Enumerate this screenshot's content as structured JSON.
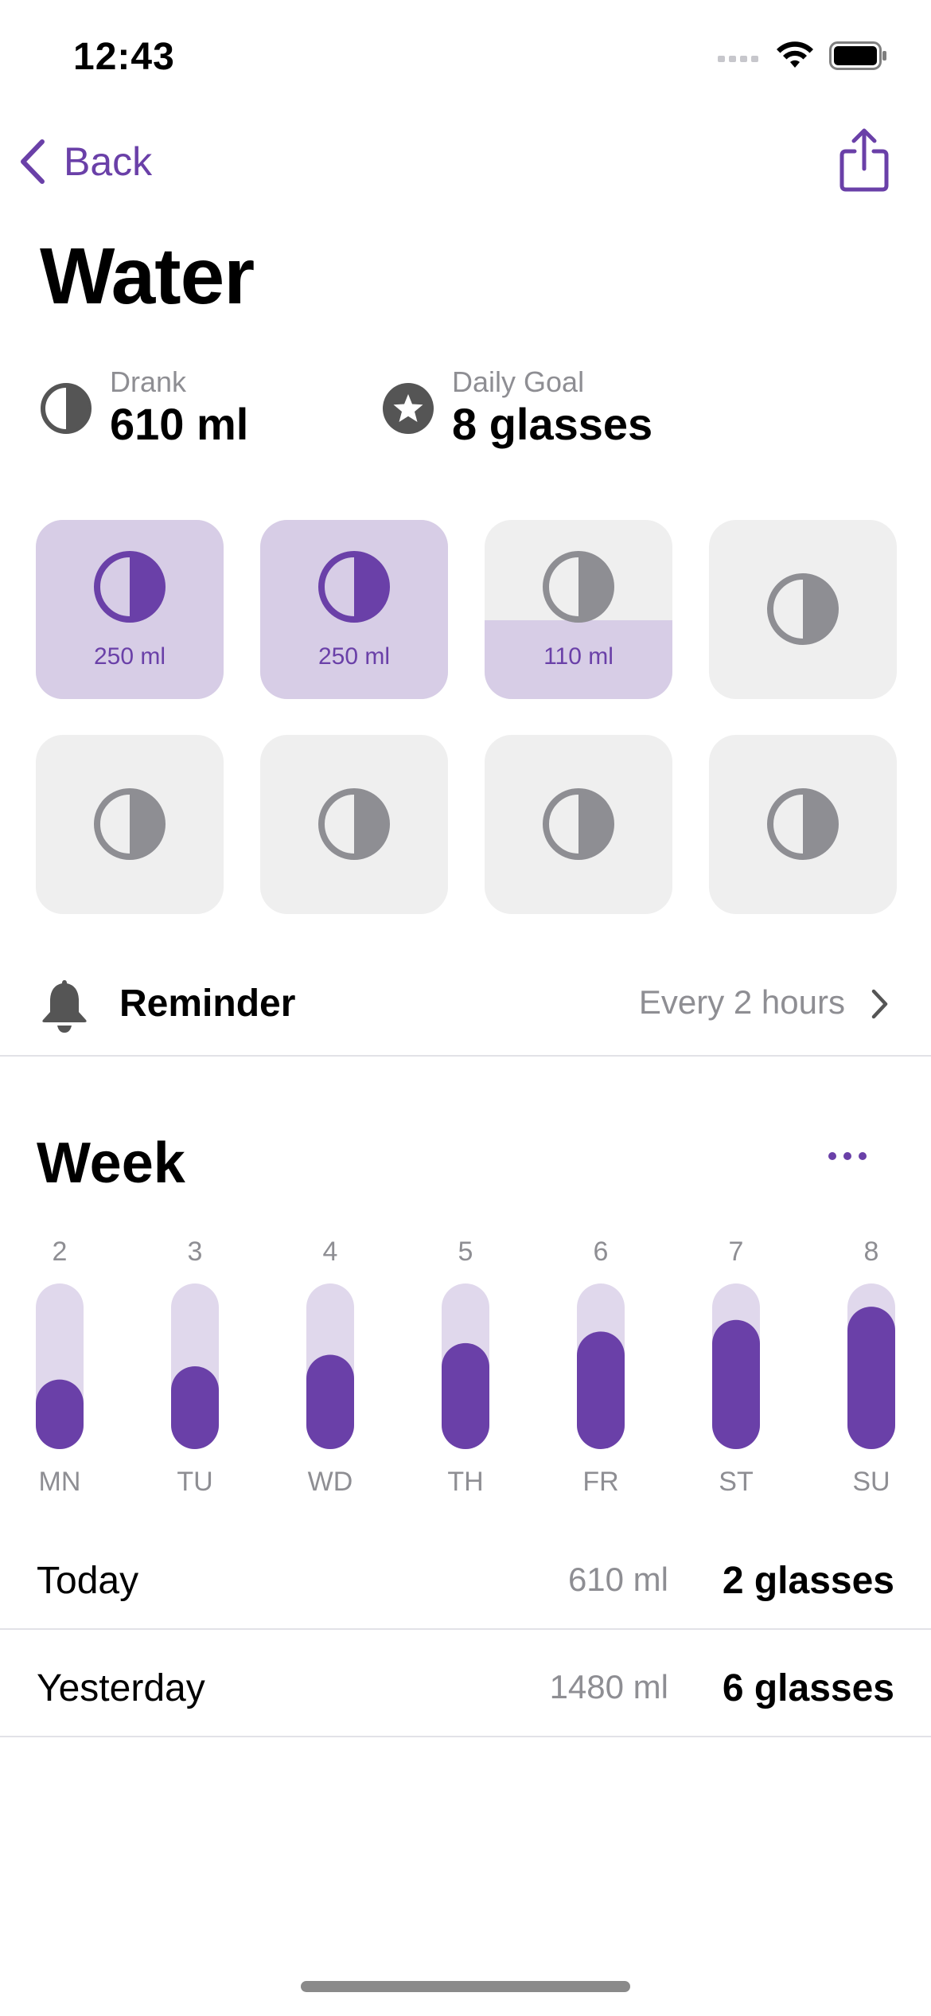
{
  "status_bar": {
    "time": "12:43"
  },
  "nav": {
    "back_label": "Back"
  },
  "title": "Water",
  "stats": {
    "drank": {
      "label": "Drank",
      "value": "610 ml"
    },
    "goal": {
      "label": "Daily Goal",
      "value": "8 glasses"
    }
  },
  "glasses": [
    {
      "amount": "250 ml",
      "fill": 1.0
    },
    {
      "amount": "250 ml",
      "fill": 1.0
    },
    {
      "amount": "110 ml",
      "fill": 0.44
    },
    {
      "amount": "",
      "fill": 0
    },
    {
      "amount": "",
      "fill": 0
    },
    {
      "amount": "",
      "fill": 0
    },
    {
      "amount": "",
      "fill": 0
    },
    {
      "amount": "",
      "fill": 0
    }
  ],
  "reminder": {
    "title": "Reminder",
    "value": "Every 2 hours"
  },
  "week": {
    "title": "Week"
  },
  "chart_data": {
    "type": "bar",
    "categories": [
      "MN",
      "TU",
      "WD",
      "TH",
      "FR",
      "ST",
      "SU"
    ],
    "dates": [
      "2",
      "3",
      "4",
      "5",
      "6",
      "7",
      "8"
    ],
    "values": [
      0.42,
      0.5,
      0.57,
      0.64,
      0.71,
      0.78,
      0.86
    ],
    "ylim": [
      0,
      1
    ]
  },
  "summary": [
    {
      "day": "Today",
      "ml": "610 ml",
      "glasses": "2 glasses"
    },
    {
      "day": "Yesterday",
      "ml": "1480 ml",
      "glasses": "6 glasses"
    }
  ],
  "colors": {
    "accent": "#6A40A8",
    "accent_light": "#D7CDE6",
    "track": "#E0D8EC",
    "icon_gray": "#8E8E93",
    "card_bg": "#EFEFEF"
  }
}
